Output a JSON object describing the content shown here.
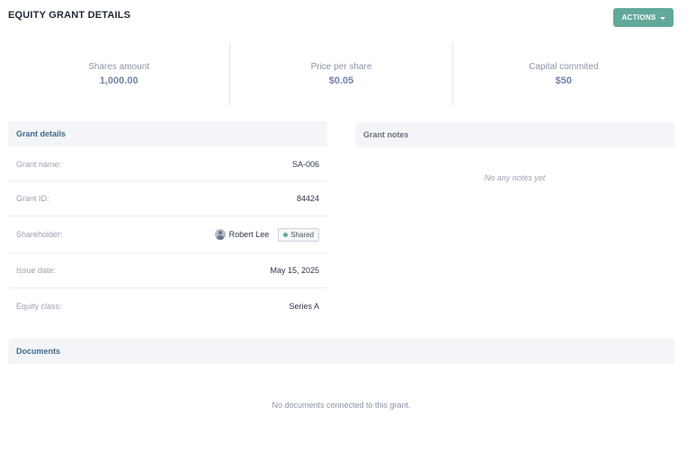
{
  "header": {
    "title": "EQUITY GRANT DETAILS",
    "actions_label": "ACTIONS"
  },
  "stats": [
    {
      "label": "Shares amount",
      "value": "1,000.00"
    },
    {
      "label": "Price per share",
      "value": "$0.05"
    },
    {
      "label": "Capital commited",
      "value": "$50"
    }
  ],
  "grant_details": {
    "title": "Grant details",
    "rows": [
      {
        "label": "Grant name:",
        "value": "SA-006"
      },
      {
        "label": "Grant ID:",
        "value": "84424"
      },
      {
        "label": "Shareholder:",
        "name": "Robert Lee",
        "badge": "Shared"
      },
      {
        "label": "Issue date:",
        "value": "May 15, 2025"
      },
      {
        "label": "Equity class:",
        "value": "Series A"
      }
    ]
  },
  "grant_notes": {
    "title": "Grant notes",
    "empty_text": "No any notes yet"
  },
  "documents": {
    "title": "Documents",
    "empty_text": "No documents connected to this grant."
  },
  "colors": {
    "accent": "#62a99a",
    "stat_value": "#7483a8",
    "section_title": "#416a8c"
  },
  "icons": {
    "actions_caret": "caret-down-icon",
    "avatar": "user-avatar-icon",
    "badge_dot": "status-dot-icon"
  }
}
